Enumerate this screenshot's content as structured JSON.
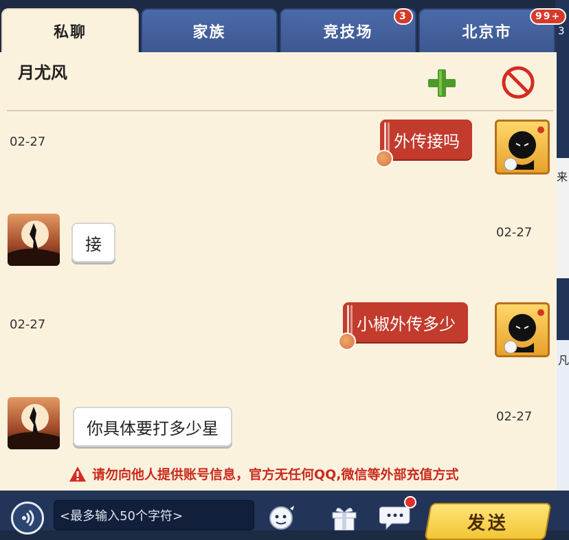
{
  "tabs": [
    {
      "label": "私聊",
      "badge": ""
    },
    {
      "label": "家族",
      "badge": ""
    },
    {
      "label": "竞技场",
      "badge": "3"
    },
    {
      "label": "北京市",
      "badge": "99+"
    }
  ],
  "chat": {
    "contact_name": "月尤风",
    "messages": [
      {
        "direction": "out",
        "text": "外传接吗",
        "time": "02-27"
      },
      {
        "direction": "in",
        "text": "接",
        "time": "02-27"
      },
      {
        "direction": "out",
        "text": "小椒外传多少",
        "time": "02-27"
      },
      {
        "direction": "in",
        "text": "你具体要打多少星",
        "time": "02-27"
      }
    ],
    "warning": "请勿向他人提供账号信息，官方无任何QQ,微信等外部充值方式"
  },
  "input": {
    "placeholder": "<最多输入50个字符>"
  },
  "send_label": "发送",
  "edge": {
    "top": "3",
    "mid": "来",
    "low": "凡"
  },
  "colors": {
    "out_bubble": "#c23b2c",
    "panel": "#fbf2de",
    "tab": "#4b6aa8",
    "send": "#f4c534"
  }
}
